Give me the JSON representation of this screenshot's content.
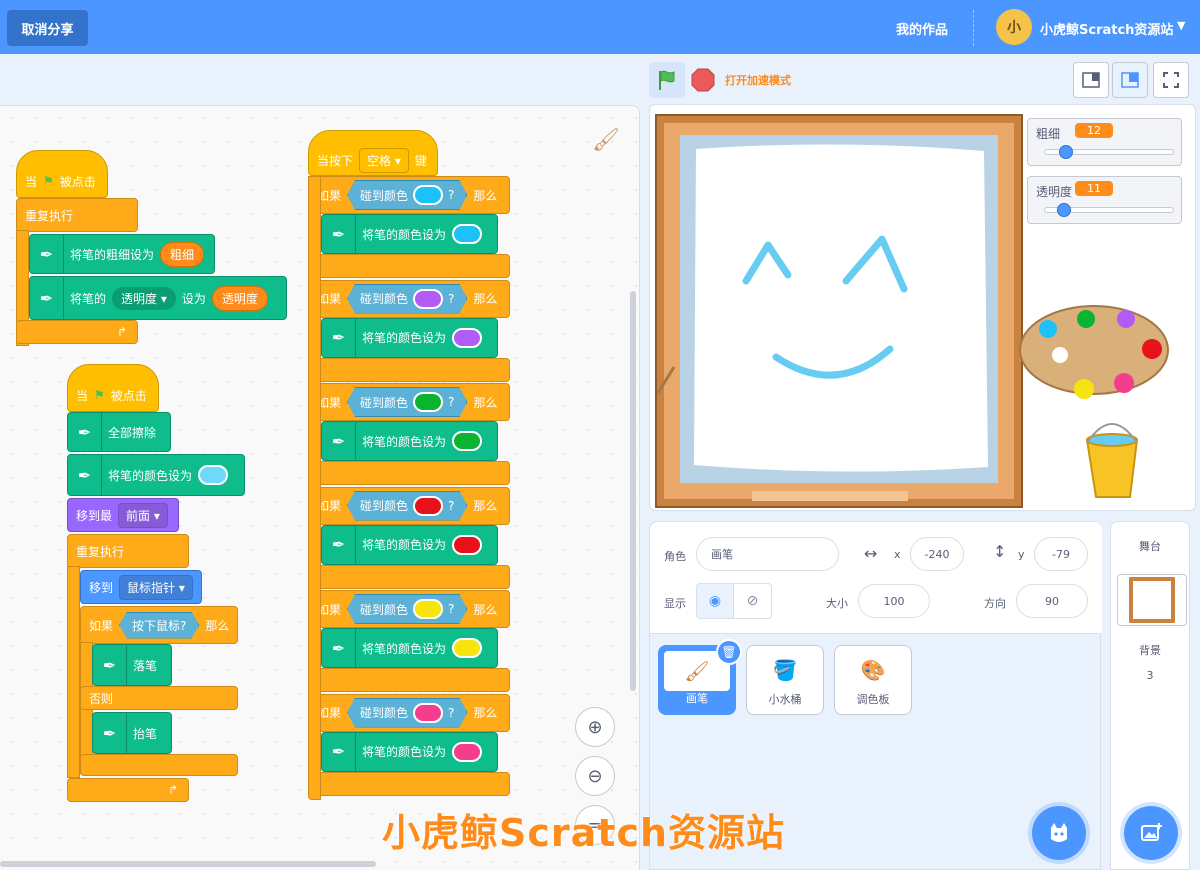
{
  "menubar": {
    "unshare_label": "取消分享",
    "mywork_label": "我的作品",
    "user_name": "小虎鲸Scratch资源站",
    "avatar_text": "小"
  },
  "toolbar": {
    "turbo_label": "打开加速模式"
  },
  "script1": {
    "when_label": "当",
    "clicked_label": "被点击",
    "repeat_label": "重复执行",
    "set_size": "将笔的粗细设为",
    "size_reporter": "粗细",
    "set_pen_of": "将笔的",
    "param": "透明度",
    "set_to": "设为",
    "trans_reporter": "透明度"
  },
  "script2": {
    "when_label": "当",
    "clicked_label": "被点击",
    "clear_all": "全部擦除",
    "set_color": "将笔的颜色设为",
    "goto_layer": "移到最",
    "layer_value": "前面",
    "repeat_label": "重复执行",
    "goto": "移到",
    "goto_target": "鼠标指针",
    "if_label": "如果",
    "mouse_down": "按下鼠标?",
    "then_label": "那么",
    "pen_down": "落笔",
    "else_label": "否则",
    "pen_up": "抬笔",
    "color_value": "#6fd8fb"
  },
  "script3": {
    "when_key": "当按下",
    "key_value": "空格",
    "key_suffix": "键",
    "if_label": "如果",
    "touching": "碰到颜色",
    "q": "?",
    "then_label": "那么",
    "set_color": "将笔的颜色设为",
    "colors": [
      "#1cc2f7",
      "#b05cf5",
      "#0ab330",
      "#e8121a",
      "#f7e40f",
      "#f53d8e"
    ]
  },
  "monitors": [
    {
      "label": "粗细",
      "value": "12",
      "level": 0.12
    },
    {
      "label": "透明度",
      "value": "11",
      "level": 0.11
    }
  ],
  "sprite_info": {
    "sprite_label": "角色",
    "sprite_name": "画笔",
    "x_label": "x",
    "x_value": "-240",
    "y_label": "y",
    "y_value": "-79",
    "show_label": "显示",
    "size_label": "大小",
    "size_value": "100",
    "dir_label": "方向",
    "dir_value": "90"
  },
  "sprites": [
    {
      "name": "画笔",
      "selected": true
    },
    {
      "name": "小水桶",
      "selected": false
    },
    {
      "name": "调色板",
      "selected": false
    }
  ],
  "stage_panel": {
    "title": "舞台",
    "backdrop_label": "背景",
    "backdrop_count": "3"
  },
  "watermark": "小虎鲸Scratch资源站"
}
